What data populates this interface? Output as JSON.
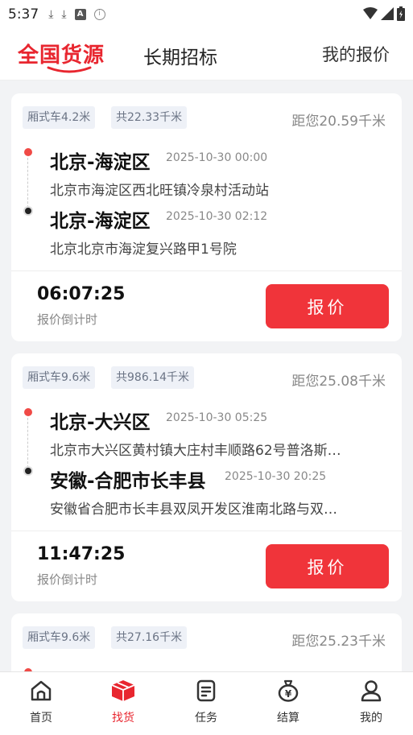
{
  "status_bar": {
    "time": "5:37"
  },
  "top_tabs": {
    "active": "全国货源",
    "second": "长期招标",
    "third": "我的报价"
  },
  "cards": [
    {
      "tag1": "厢式车4.2米",
      "tag2": "共22.33千米",
      "distance": "距您20.59千米",
      "origin_city": "北京-海淀区",
      "origin_time": "2025-10-30 00:00",
      "origin_addr": "北京市海淀区西北旺镇冷泉村活动站",
      "dest_city": "北京-海淀区",
      "dest_time": "2025-10-30 02:12",
      "dest_addr": "北京北京市海淀复兴路甲1号院",
      "countdown": "06:07:25",
      "countdown_label": "报价倒计时",
      "button": "报价"
    },
    {
      "tag1": "厢式车9.6米",
      "tag2": "共986.14千米",
      "distance": "距您25.08千米",
      "origin_city": "北京-大兴区",
      "origin_time": "2025-10-30 05:25",
      "origin_addr": "北京市大兴区黄村镇大庄村丰顺路62号普洛斯…",
      "dest_city": "安徽-合肥市长丰县",
      "dest_time": "2025-10-30 20:25",
      "dest_addr": "安徽省合肥市长丰县双凤开发区淮南北路与双…",
      "countdown": "11:47:25",
      "countdown_label": "报价倒计时",
      "button": "报价"
    },
    {
      "tag1": "厢式车9.6米",
      "tag2": "共27.16千米",
      "distance": "距您25.23千米"
    }
  ],
  "bottom_nav": [
    {
      "label": "首页",
      "icon": "home-icon"
    },
    {
      "label": "找货",
      "icon": "cargo-box-icon"
    },
    {
      "label": "任务",
      "icon": "task-doc-icon"
    },
    {
      "label": "结算",
      "icon": "money-bag-icon"
    },
    {
      "label": "我的",
      "icon": "person-icon"
    }
  ],
  "colors": {
    "accent": "#e8262f",
    "button": "#f0343a"
  }
}
